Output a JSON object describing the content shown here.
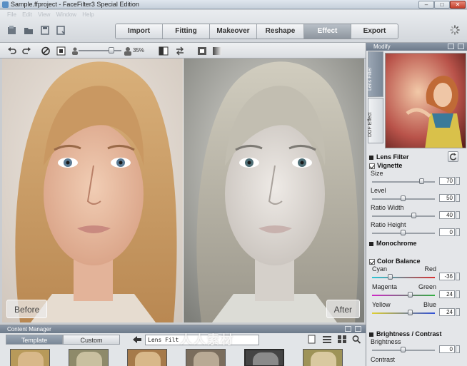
{
  "window": {
    "title": "Sample.ffproject - FaceFilter3 Special Edition",
    "minimize": "–",
    "maximize": "□",
    "close": "✕"
  },
  "menu": [
    "File",
    "Edit",
    "View",
    "Window",
    "Help"
  ],
  "tabs": [
    {
      "label": "Import",
      "active": false
    },
    {
      "label": "Fitting",
      "active": false
    },
    {
      "label": "Makeover",
      "active": false
    },
    {
      "label": "Reshape",
      "active": false
    },
    {
      "label": "Effect",
      "active": true
    },
    {
      "label": "Export",
      "active": false
    }
  ],
  "toolbar": {
    "zoom": "35%"
  },
  "photos": {
    "before_label": "Before",
    "after_label": "After"
  },
  "content_manager": {
    "title": "Content Manager",
    "tabs": [
      {
        "label": "Template",
        "active": true
      },
      {
        "label": "Custom",
        "active": false
      }
    ],
    "selector": "Lens Filt"
  },
  "watermark": "人人素材",
  "right_panel": {
    "title": "Modify",
    "vtabs": [
      {
        "label": "Lens Filter",
        "active": true
      },
      {
        "label": "DOF Effect",
        "active": false
      }
    ],
    "lens_filter": {
      "title": "Lens Filter",
      "vignette": {
        "title": "Vignette",
        "params": [
          {
            "label": "Size",
            "value": "70"
          },
          {
            "label": "Level",
            "value": "50"
          },
          {
            "label": "Ratio Width",
            "value": "40"
          },
          {
            "label": "Ratio Height",
            "value": "0"
          }
        ]
      },
      "monochrome": {
        "title": "Monochrome"
      },
      "color_balance": {
        "title": "Color Balance",
        "params": [
          {
            "left": "Cyan",
            "right": "Red",
            "value": "-36"
          },
          {
            "left": "Magenta",
            "right": "Green",
            "value": "24"
          },
          {
            "left": "Yellow",
            "right": "Blue",
            "value": "24"
          }
        ]
      },
      "brightness_contrast": {
        "title": "Brightness / Contrast",
        "params": [
          {
            "label": "Brightness",
            "value": "0"
          },
          {
            "label": "Contrast",
            "value": ""
          }
        ]
      }
    }
  },
  "colors": {
    "accent_tab": "#8e969f",
    "panel_header": "#7b8897"
  }
}
